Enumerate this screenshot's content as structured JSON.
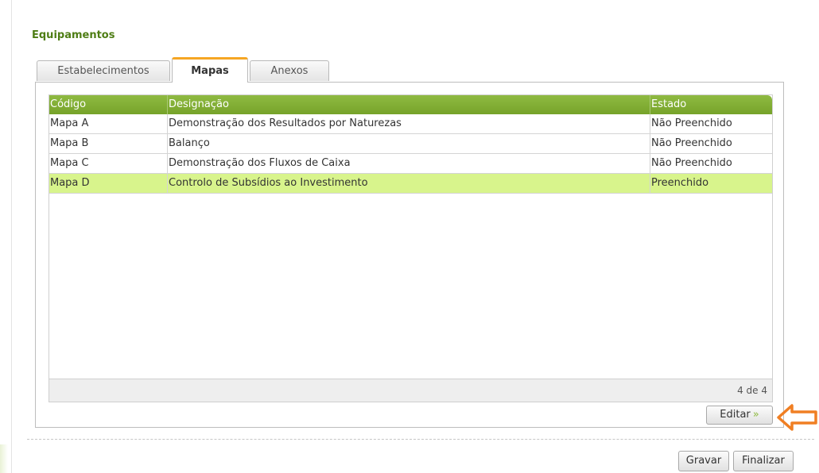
{
  "section": {
    "title": "Equipamentos"
  },
  "tabs": [
    {
      "label": "Estabelecimentos",
      "active": false
    },
    {
      "label": "Mapas",
      "active": true
    },
    {
      "label": "Anexos",
      "active": false
    }
  ],
  "grid": {
    "columns": [
      "Código",
      "Designação",
      "Estado"
    ],
    "rows": [
      {
        "codigo": "Mapa A",
        "designacao": "Demonstração dos Resultados por Naturezas",
        "estado": "Não Preenchido",
        "selected": false
      },
      {
        "codigo": "Mapa B",
        "designacao": "Balanço",
        "estado": "Não Preenchido",
        "selected": false
      },
      {
        "codigo": "Mapa C",
        "designacao": "Demonstração dos Fluxos de Caixa",
        "estado": "Não Preenchido",
        "selected": false
      },
      {
        "codigo": "Mapa D",
        "designacao": "Controlo de Subsídios ao Investimento",
        "estado": "Preenchido",
        "selected": true
      }
    ],
    "pager_text": "4 de 4"
  },
  "actions": {
    "edit_label": "Editar",
    "edit_chevron": "»",
    "save_label": "Gravar",
    "finish_label": "Finalizar"
  },
  "icons": {
    "edit_chevron": "chevron-right-double-icon",
    "pointer_arrow": "arrow-left-icon"
  },
  "colors": {
    "header_green": "#7faf33",
    "title_green": "#4e7d14",
    "active_tab_accent": "#f6a623",
    "selected_row": "#d8f48c",
    "arrow_orange": "#f07f23"
  }
}
